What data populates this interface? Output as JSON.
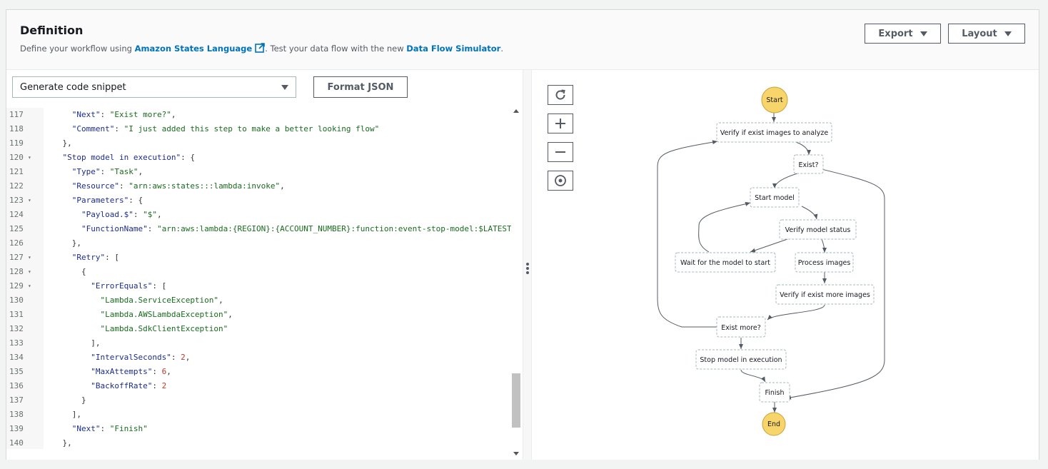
{
  "header": {
    "title": "Definition",
    "subtitle_prefix": "Define your workflow using ",
    "asl_link": "Amazon States Language",
    "subtitle_mid": ". Test your data flow with the new ",
    "simulator_link": "Data Flow Simulator",
    "subtitle_suffix": ".",
    "export_label": "Export",
    "layout_label": "Layout"
  },
  "editor": {
    "snippet_select": "Generate code snippet",
    "format_label": "Format JSON",
    "lines": [
      {
        "no": "117",
        "fold": false,
        "indent": 6,
        "tokens": [
          [
            "k",
            "\"Next\""
          ],
          [
            "p",
            ": "
          ],
          [
            "s",
            "\"Exist more?\""
          ],
          [
            "p",
            ","
          ]
        ]
      },
      {
        "no": "118",
        "fold": false,
        "indent": 6,
        "tokens": [
          [
            "k",
            "\"Comment\""
          ],
          [
            "p",
            ": "
          ],
          [
            "s",
            "\"I just added this step to make a better looking flow\""
          ]
        ]
      },
      {
        "no": "119",
        "fold": false,
        "indent": 4,
        "tokens": [
          [
            "p",
            "},"
          ]
        ]
      },
      {
        "no": "120",
        "fold": true,
        "indent": 4,
        "tokens": [
          [
            "k",
            "\"Stop model in execution\""
          ],
          [
            "p",
            ": {"
          ]
        ]
      },
      {
        "no": "121",
        "fold": false,
        "indent": 6,
        "tokens": [
          [
            "k",
            "\"Type\""
          ],
          [
            "p",
            ": "
          ],
          [
            "s",
            "\"Task\""
          ],
          [
            "p",
            ","
          ]
        ]
      },
      {
        "no": "122",
        "fold": false,
        "indent": 6,
        "tokens": [
          [
            "k",
            "\"Resource\""
          ],
          [
            "p",
            ": "
          ],
          [
            "s",
            "\"arn:aws:states:::lambda:invoke\""
          ],
          [
            "p",
            ","
          ]
        ]
      },
      {
        "no": "123",
        "fold": true,
        "indent": 6,
        "tokens": [
          [
            "k",
            "\"Parameters\""
          ],
          [
            "p",
            ": {"
          ]
        ]
      },
      {
        "no": "124",
        "fold": false,
        "indent": 8,
        "tokens": [
          [
            "k",
            "\"Payload.$\""
          ],
          [
            "p",
            ": "
          ],
          [
            "s",
            "\"$\""
          ],
          [
            "p",
            ","
          ]
        ]
      },
      {
        "no": "125",
        "fold": false,
        "indent": 8,
        "tokens": [
          [
            "k",
            "\"FunctionName\""
          ],
          [
            "p",
            ": "
          ],
          [
            "s",
            "\"arn:aws:lambda:{REGION}:{ACCOUNT_NUMBER}:function:event-stop-model:$LATEST\""
          ]
        ]
      },
      {
        "no": "126",
        "fold": false,
        "indent": 6,
        "tokens": [
          [
            "p",
            "},"
          ]
        ]
      },
      {
        "no": "127",
        "fold": true,
        "indent": 6,
        "tokens": [
          [
            "k",
            "\"Retry\""
          ],
          [
            "p",
            ": ["
          ]
        ]
      },
      {
        "no": "128",
        "fold": true,
        "indent": 8,
        "tokens": [
          [
            "p",
            "{"
          ]
        ]
      },
      {
        "no": "129",
        "fold": true,
        "indent": 10,
        "tokens": [
          [
            "k",
            "\"ErrorEquals\""
          ],
          [
            "p",
            ": ["
          ]
        ]
      },
      {
        "no": "130",
        "fold": false,
        "indent": 12,
        "tokens": [
          [
            "s",
            "\"Lambda.ServiceException\""
          ],
          [
            "p",
            ","
          ]
        ]
      },
      {
        "no": "131",
        "fold": false,
        "indent": 12,
        "tokens": [
          [
            "s",
            "\"Lambda.AWSLambdaException\""
          ],
          [
            "p",
            ","
          ]
        ]
      },
      {
        "no": "132",
        "fold": false,
        "indent": 12,
        "tokens": [
          [
            "s",
            "\"Lambda.SdkClientException\""
          ]
        ]
      },
      {
        "no": "133",
        "fold": false,
        "indent": 10,
        "tokens": [
          [
            "p",
            "],"
          ]
        ]
      },
      {
        "no": "134",
        "fold": false,
        "indent": 10,
        "tokens": [
          [
            "k",
            "\"IntervalSeconds\""
          ],
          [
            "p",
            ": "
          ],
          [
            "n",
            "2"
          ],
          [
            "p",
            ","
          ]
        ]
      },
      {
        "no": "135",
        "fold": false,
        "indent": 10,
        "tokens": [
          [
            "k",
            "\"MaxAttempts\""
          ],
          [
            "p",
            ": "
          ],
          [
            "n",
            "6"
          ],
          [
            "p",
            ","
          ]
        ]
      },
      {
        "no": "136",
        "fold": false,
        "indent": 10,
        "tokens": [
          [
            "k",
            "\"BackoffRate\""
          ],
          [
            "p",
            ": "
          ],
          [
            "n",
            "2"
          ]
        ]
      },
      {
        "no": "137",
        "fold": false,
        "indent": 8,
        "tokens": [
          [
            "p",
            "}"
          ]
        ]
      },
      {
        "no": "138",
        "fold": false,
        "indent": 6,
        "tokens": [
          [
            "p",
            "],"
          ]
        ]
      },
      {
        "no": "139",
        "fold": false,
        "indent": 6,
        "tokens": [
          [
            "k",
            "\"Next\""
          ],
          [
            "p",
            ": "
          ],
          [
            "s",
            "\"Finish\""
          ]
        ]
      },
      {
        "no": "140",
        "fold": false,
        "indent": 4,
        "tokens": [
          [
            "p",
            "},"
          ]
        ]
      }
    ]
  },
  "graph": {
    "tools": [
      "refresh-icon",
      "zoom-in-icon",
      "zoom-out-icon",
      "center-icon"
    ],
    "nodes": {
      "start": "Start",
      "verify_images": "Verify if exist images to analyze",
      "exist": "Exist?",
      "start_model": "Start model",
      "verify_status": "Verify model status",
      "wait": "Wait for the model to start",
      "process": "Process images",
      "verify_more": "Verify if exist more images",
      "exist_more": "Exist more?",
      "stop_model": "Stop model in execution",
      "finish": "Finish",
      "end": "End"
    }
  },
  "colors": {
    "link": "#0073bb",
    "terminal_fill": "#f7d56b",
    "terminal_stroke": "#c8a23a",
    "node_border": "#aab7b8"
  }
}
